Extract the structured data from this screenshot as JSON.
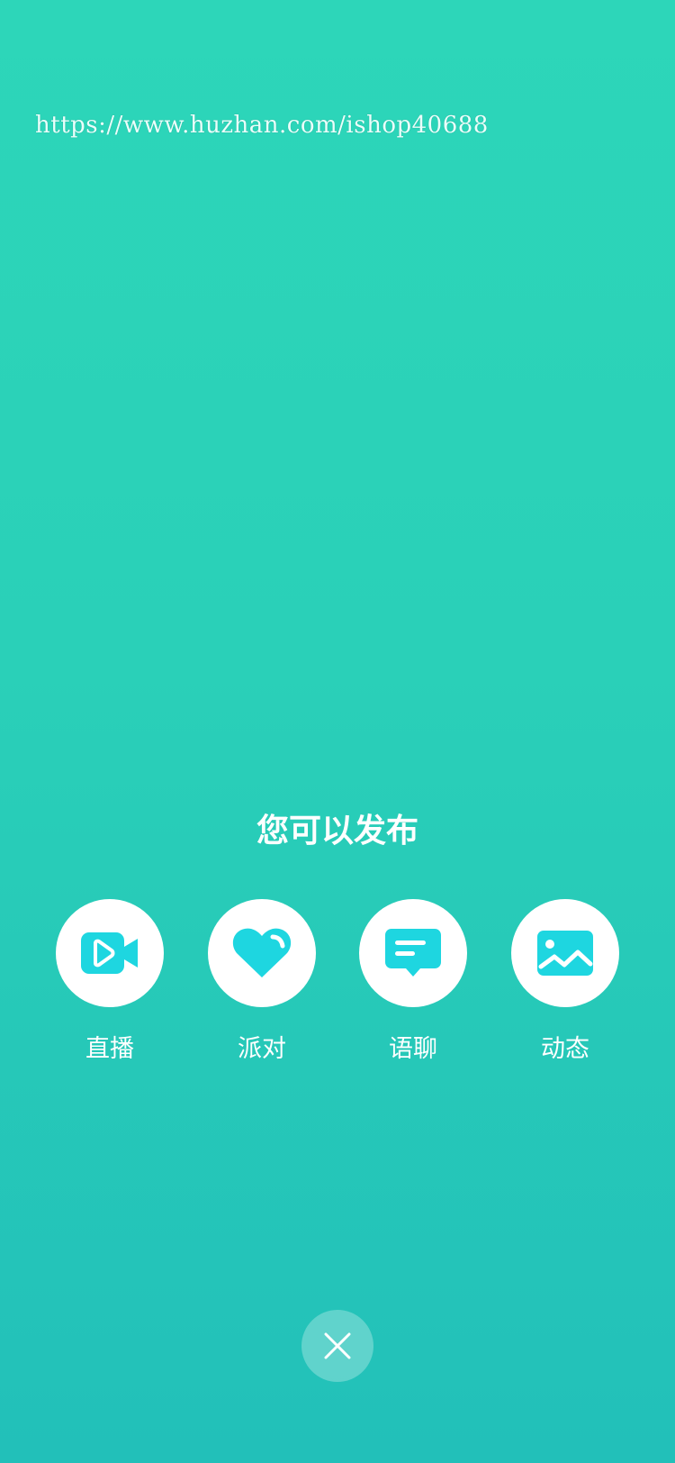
{
  "watermark": "https://www.huzhan.com/ishop40688",
  "prompt_title": "您可以发布",
  "options": [
    {
      "label": "直播",
      "icon": "video-camera-icon"
    },
    {
      "label": "派对",
      "icon": "heart-icon"
    },
    {
      "label": "语聊",
      "icon": "chat-bubble-icon"
    },
    {
      "label": "动态",
      "icon": "image-icon"
    }
  ],
  "close_icon": "close-icon",
  "colors": {
    "background_top": "#2dd6b9",
    "background_bottom": "#22c0b9",
    "icon_accent": "#1ed6e0",
    "circle": "#ffffff"
  }
}
